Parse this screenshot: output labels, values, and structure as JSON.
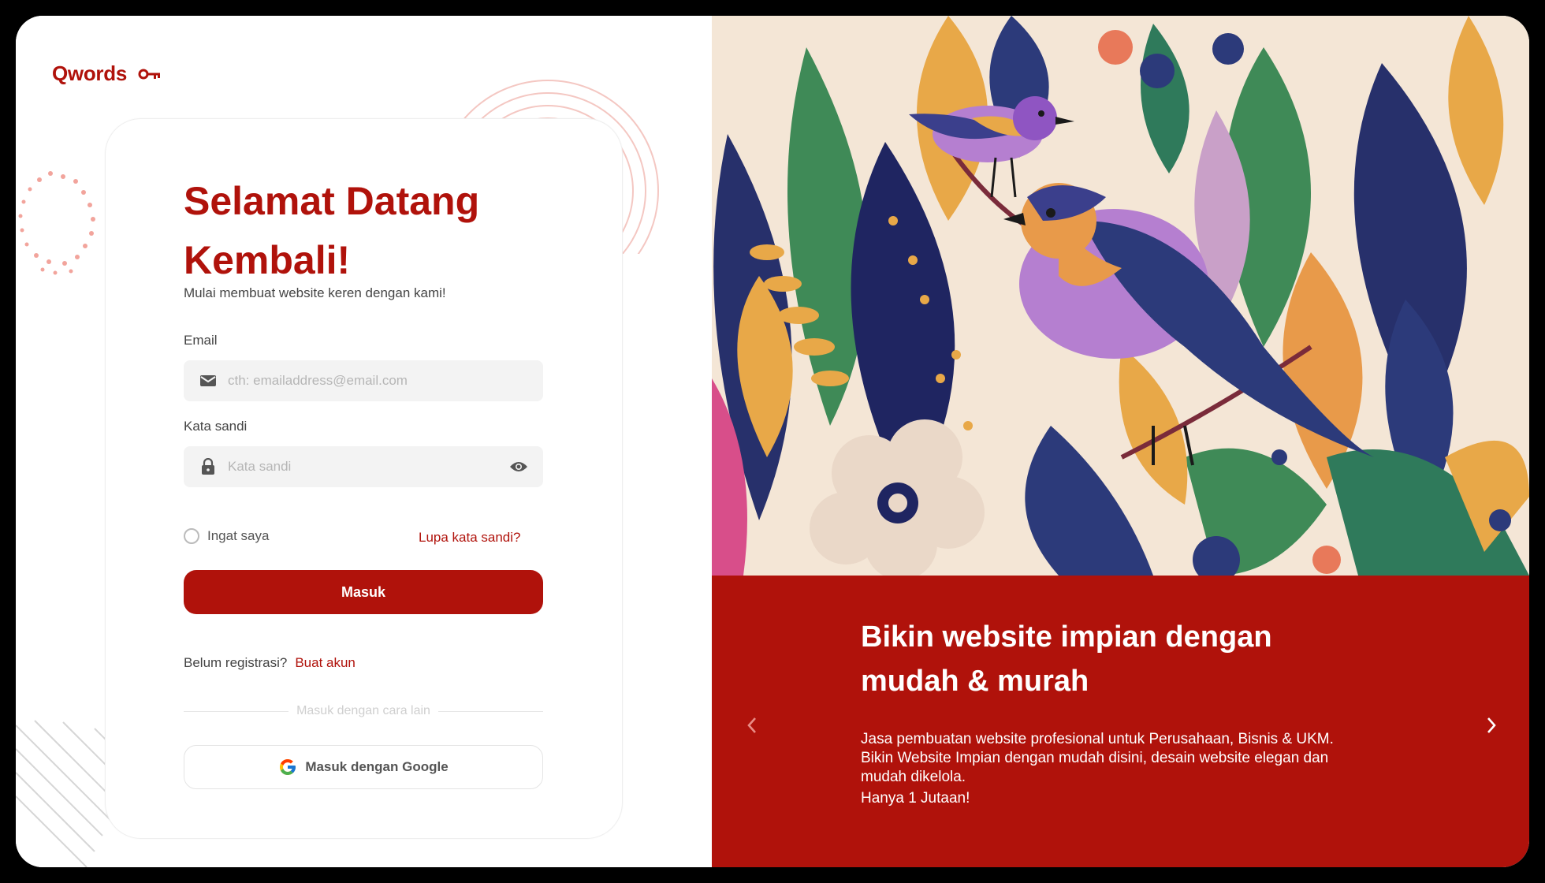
{
  "brand": {
    "name": "Qwords",
    "icon": "key-icon"
  },
  "login": {
    "title": "Selamat Datang Kembali!",
    "subtitle": "Mulai membuat website keren dengan kami!",
    "email_label": "Email",
    "email_placeholder": "cth: emailaddress@email.com",
    "password_label": "Kata sandi",
    "password_placeholder": "Kata sandi",
    "remember_label": "Ingat saya",
    "forgot_label": "Lupa kata sandi?",
    "submit_label": "Masuk",
    "register_prompt": "Belum registrasi?",
    "register_link": "Buat akun",
    "divider_label": "Masuk dengan cara lain",
    "google_label": "Masuk dengan Google",
    "icons": [
      "mail-icon",
      "lock-icon",
      "eye-icon",
      "google-icon"
    ]
  },
  "promo": {
    "title": "Bikin website impian dengan mudah & murah",
    "text": "Jasa pembuatan website profesional untuk Perusahaan, Bisnis & UKM. Bikin Website Impian dengan mudah disini, desain website elegan dan mudah dikelola.",
    "subtext": "Hanya 1 Jutaan!",
    "icons": [
      "chevron-left-icon",
      "chevron-right-icon"
    ]
  },
  "colors": {
    "brand": "#b0120b",
    "field_bg": "#f3f3f3",
    "promo_bg": "#b0120b"
  }
}
